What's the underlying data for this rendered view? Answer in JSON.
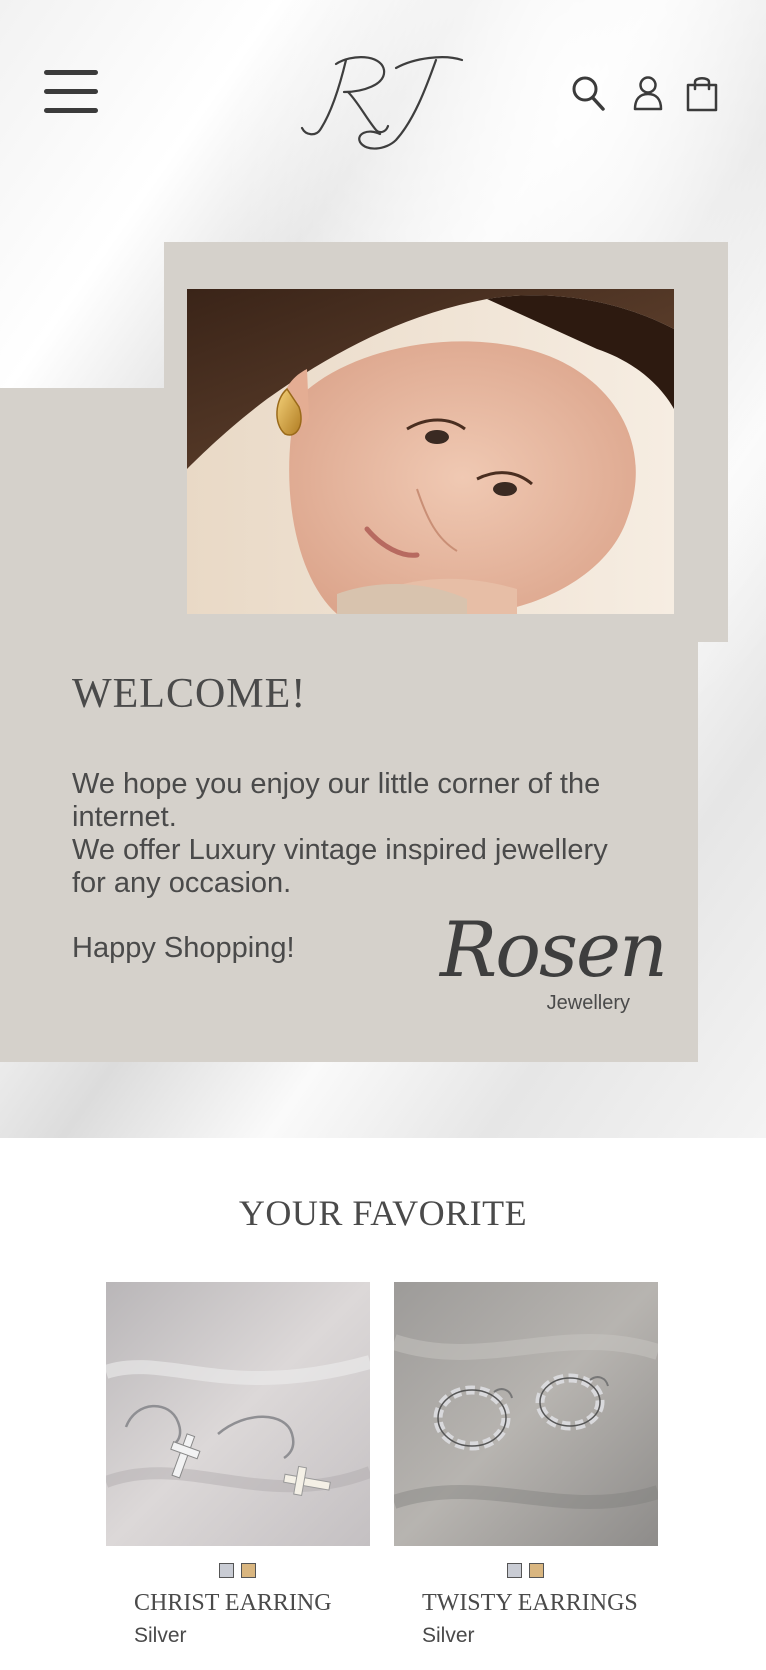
{
  "header": {
    "logo_text": "RJ",
    "menu_icon": "hamburger-menu-icon",
    "icons": [
      "search-icon",
      "user-account-icon",
      "shopping-bag-icon"
    ]
  },
  "hero": {
    "photo_alt": "Woman wearing gold hoop earring resting head on hand",
    "welcome_title": "WELCOME!",
    "intro_lines": [
      "We hope you enjoy our little corner of the internet.",
      "We offer Luxury vintage inspired jewellery for any occasion."
    ],
    "closing": "Happy Shopping!",
    "brand_script": "Rosen",
    "brand_sub": "Jewellery"
  },
  "favorites": {
    "title": "YOUR FAVORITE",
    "products": [
      {
        "name": "CHRIST EARRING",
        "variant": "Silver",
        "swatches": [
          "#c9ccd4",
          "#d9b680"
        ]
      },
      {
        "name": "TWISTY EARRINGS",
        "variant": "Silver",
        "swatches": [
          "#c9ccd4",
          "#d9b680"
        ]
      }
    ]
  },
  "colors": {
    "panel": "#d5d1cb",
    "text": "#4a4a4a",
    "icon": "#3b3b3b"
  }
}
